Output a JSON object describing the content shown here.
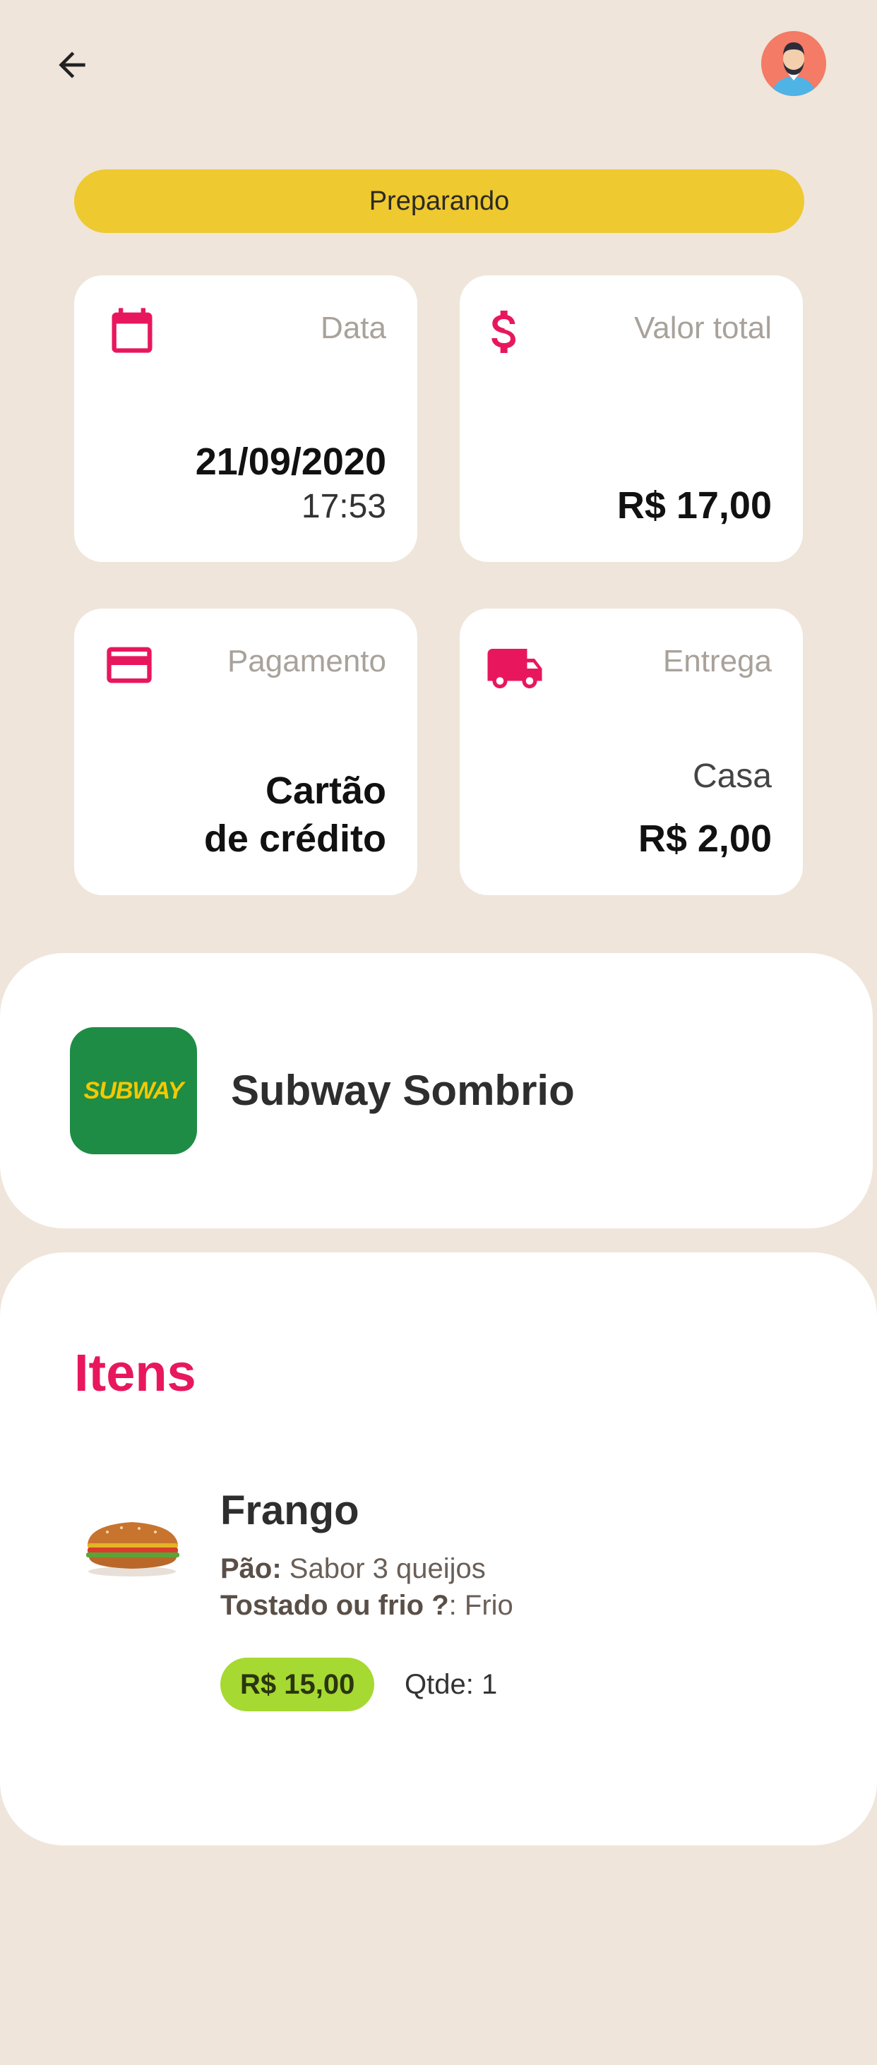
{
  "header": {
    "back_icon": "arrow-left-icon",
    "avatar_icon": "user-avatar-icon"
  },
  "status": {
    "label": "Preparando",
    "color": "#eec930"
  },
  "cards": {
    "date": {
      "icon": "calendar-icon",
      "label": "Data",
      "date": "21/09/2020",
      "time": "17:53"
    },
    "total": {
      "icon": "dollar-icon",
      "label": "Valor total",
      "value": "R$ 17,00"
    },
    "payment": {
      "icon": "credit-card-icon",
      "label": "Pagamento",
      "line1": "Cartão",
      "line2": "de crédito"
    },
    "delivery": {
      "icon": "truck-icon",
      "label": "Entrega",
      "type": "Casa",
      "fee": "R$ 2,00"
    }
  },
  "store": {
    "logo_text": "SUBWAY",
    "name": "Subway Sombrio"
  },
  "items_section": {
    "title": "Itens",
    "items": [
      {
        "name": "Frango",
        "option1_label": "Pão:",
        "option1_value": " Sabor 3 queijos",
        "option2_label": "Tostado ou frio ?",
        "option2_value": ": Frio",
        "price": "R$ 15,00",
        "qty": "Qtde: 1"
      }
    ]
  },
  "colors": {
    "accent": "#e8175d",
    "background": "#efe5da",
    "price_pill": "#a6d932",
    "store_green": "#1e8c45"
  }
}
